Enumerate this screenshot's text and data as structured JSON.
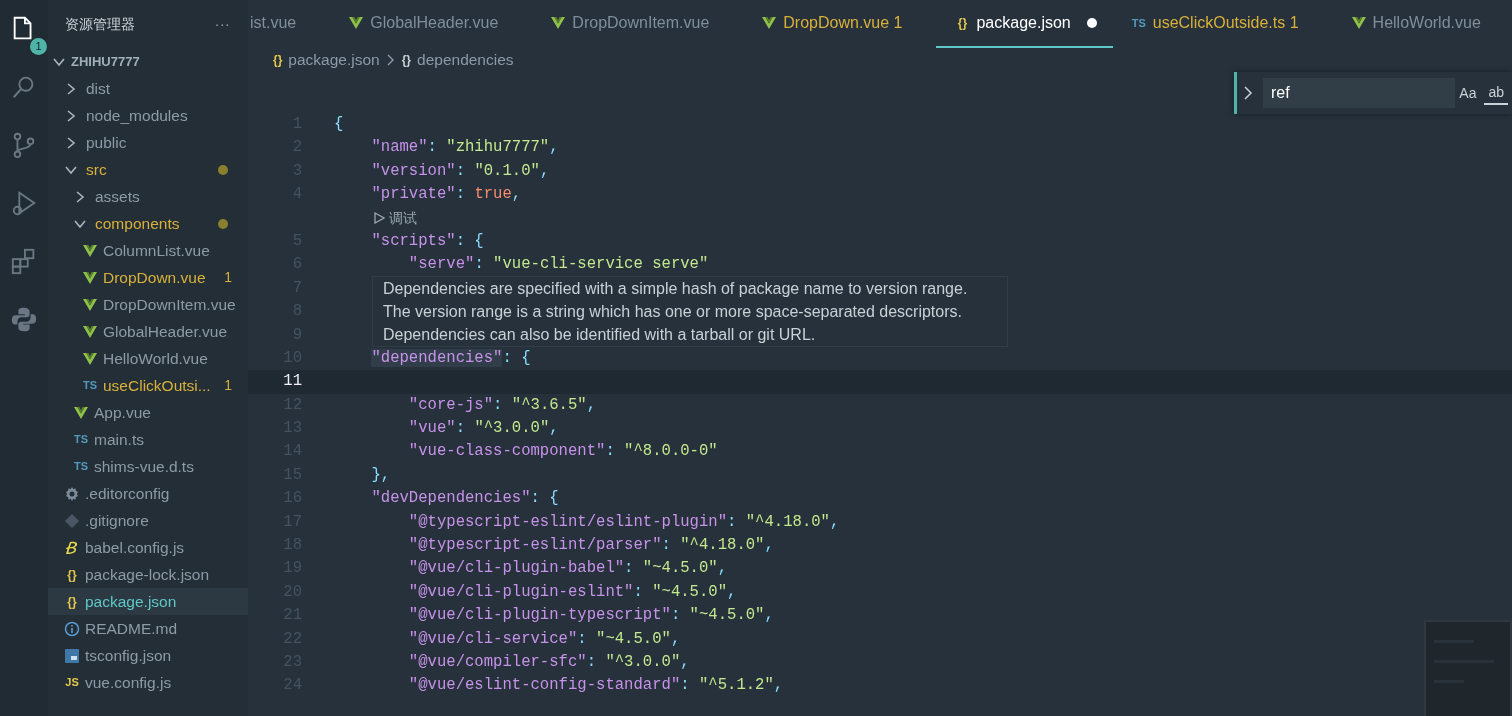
{
  "activity_bar": [
    {
      "kind": "files",
      "selected": true,
      "badge": "1"
    },
    {
      "kind": "search",
      "selected": false
    },
    {
      "kind": "source-control",
      "selected": false
    },
    {
      "kind": "run",
      "selected": false
    },
    {
      "kind": "extensions",
      "selected": false
    },
    {
      "kind": "python",
      "selected": false
    }
  ],
  "sidebar": {
    "title": "资源管理器",
    "more": "···",
    "tree": [
      {
        "kind": "root",
        "name": "ZHIHU7777",
        "expanded": true,
        "children": [
          {
            "kind": "folder",
            "name": "dist",
            "expanded": false,
            "modified": false,
            "selected": false
          },
          {
            "kind": "folder",
            "name": "node_modules",
            "expanded": false,
            "modified": false,
            "selected": false
          },
          {
            "kind": "folder",
            "name": "public",
            "expanded": false,
            "modified": false,
            "selected": false
          },
          {
            "kind": "folder",
            "name": "src",
            "expanded": true,
            "modified": true,
            "selected": false,
            "children": [
              {
                "kind": "folder",
                "name": "assets",
                "expanded": false,
                "modified": false,
                "selected": false
              },
              {
                "kind": "folder",
                "name": "components",
                "expanded": true,
                "modified": true,
                "selected": false,
                "children": [
                  {
                    "kind": "vue-file",
                    "name": "ColumnList.vue",
                    "modified": false,
                    "selected": false
                  },
                  {
                    "kind": "vue-file",
                    "name": "DropDown.vue",
                    "modified": true,
                    "problems": "1",
                    "selected": false
                  },
                  {
                    "kind": "vue-file",
                    "name": "DropDownItem.vue",
                    "modified": false,
                    "selected": false
                  },
                  {
                    "kind": "vue-file",
                    "name": "GlobalHeader.vue",
                    "modified": false,
                    "selected": false
                  },
                  {
                    "kind": "vue-file",
                    "name": "HelloWorld.vue",
                    "modified": false,
                    "selected": false
                  },
                  {
                    "kind": "ts-file",
                    "icon_label": "TS",
                    "name": "useClickOutsi...",
                    "modified": true,
                    "problems": "1",
                    "selected": false
                  }
                ]
              },
              {
                "kind": "vue-file",
                "name": "App.vue",
                "modified": false,
                "selected": false
              },
              {
                "kind": "ts-file",
                "icon_label": "TS",
                "name": "main.ts",
                "modified": false,
                "selected": false
              },
              {
                "kind": "ts-file",
                "icon_label": "TS",
                "name": "shims-vue.d.ts",
                "modified": false,
                "selected": false
              }
            ]
          },
          {
            "kind": "config-file",
            "name": ".editorconfig",
            "modified": false,
            "selected": false
          },
          {
            "kind": "ignore-file",
            "name": ".gitignore",
            "modified": false,
            "selected": false
          },
          {
            "kind": "babel-file",
            "name": "babel.config.js",
            "modified": false,
            "selected": false
          },
          {
            "kind": "json-file",
            "icon_label": "{}",
            "name": "package-lock.json",
            "modified": false,
            "selected": false
          },
          {
            "kind": "json-file",
            "icon_label": "{}",
            "name": "package.json",
            "modified": false,
            "selected": true
          },
          {
            "kind": "readme-file",
            "name": "README.md",
            "modified": false,
            "selected": false
          },
          {
            "kind": "tsconfig-file",
            "name": "tsconfig.json",
            "modified": false,
            "selected": false
          },
          {
            "kind": "js-file",
            "icon_label": "JS",
            "name": "vue.config.js",
            "modified": false,
            "selected": false
          }
        ]
      }
    ]
  },
  "tabs": [
    {
      "kind": "partial",
      "label": "ist.vue",
      "modified": false,
      "dirty": false,
      "selected": false
    },
    {
      "kind": "vue-file",
      "label": "GlobalHeader.vue",
      "modified": false,
      "dirty": false,
      "selected": false
    },
    {
      "kind": "vue-file",
      "label": "DropDownItem.vue",
      "modified": false,
      "dirty": false,
      "selected": false
    },
    {
      "kind": "vue-file",
      "label": "DropDown.vue",
      "modified": true,
      "problems": "1",
      "dirty": false,
      "selected": false
    },
    {
      "kind": "json-file",
      "icon_label": "{}",
      "label": "package.json",
      "modified": false,
      "dirty": true,
      "selected": true
    },
    {
      "kind": "ts-file",
      "icon_label": "TS",
      "label": "useClickOutside.ts",
      "modified": true,
      "problems": "1",
      "dirty": false,
      "selected": false
    },
    {
      "kind": "vue-file",
      "label": "HelloWorld.vue",
      "modified": false,
      "dirty": false,
      "selected": false
    }
  ],
  "breadcrumb": [
    {
      "icon_label": "{}",
      "text": "package.json"
    },
    {
      "icon_label": "{}",
      "text": "dependencies"
    }
  ],
  "find_widget": {
    "value": "ref",
    "options": [
      "Aa",
      "ab"
    ]
  },
  "code": [
    {
      "kind": "line",
      "number": "1",
      "current": false,
      "tokens": [
        {
          "kind": "punct",
          "text": "{"
        }
      ]
    },
    {
      "kind": "line",
      "number": "2",
      "current": false,
      "tokens": [
        {
          "kind": "key",
          "text": "    \"name\""
        },
        {
          "kind": "punct",
          "text": ": "
        },
        {
          "kind": "str",
          "text": "\"zhihu7777\""
        },
        {
          "kind": "punct",
          "text": ","
        }
      ]
    },
    {
      "kind": "line",
      "number": "3",
      "current": false,
      "tokens": [
        {
          "kind": "key",
          "text": "    \"version\""
        },
        {
          "kind": "punct",
          "text": ": "
        },
        {
          "kind": "str",
          "text": "\"0.1.0\""
        },
        {
          "kind": "punct",
          "text": ","
        }
      ]
    },
    {
      "kind": "line",
      "number": "4",
      "current": false,
      "tokens": [
        {
          "kind": "key",
          "text": "    \"private\""
        },
        {
          "kind": "punct",
          "text": ": "
        },
        {
          "kind": "bool",
          "text": "true"
        },
        {
          "kind": "punct",
          "text": ","
        }
      ]
    },
    {
      "kind": "codelens",
      "text": "调试"
    },
    {
      "kind": "line",
      "number": "5",
      "current": false,
      "tokens": [
        {
          "kind": "key",
          "text": "    \"scripts\""
        },
        {
          "kind": "punct",
          "text": ": {"
        }
      ]
    },
    {
      "kind": "line",
      "number": "6",
      "current": false,
      "tokens": [
        {
          "kind": "key",
          "text": "        \"serve\""
        },
        {
          "kind": "punct",
          "text": ": "
        },
        {
          "kind": "str",
          "text": "\"vue-cli-service serve\""
        }
      ]
    },
    {
      "kind": "line",
      "number": "7",
      "current": false
    },
    {
      "kind": "line",
      "number": "8",
      "current": false
    },
    {
      "kind": "line",
      "number": "9",
      "current": false
    },
    {
      "kind": "tooltip",
      "text": "Dependencies are specified with a simple hash of package name to version range. The version range is a string which has one or more space-separated descriptors. Dependencies can also be identified with a tarball or git URL."
    },
    {
      "kind": "line",
      "number": "10",
      "current": false,
      "tokens": [
        {
          "kind": "key",
          "text": "    \"dependencies\"",
          "hovered": true
        },
        {
          "kind": "punct",
          "text": ": {"
        }
      ]
    },
    {
      "kind": "line",
      "number": "11",
      "current": true
    },
    {
      "kind": "line",
      "number": "12",
      "current": false,
      "tokens": [
        {
          "kind": "key",
          "text": "        \"core-js\""
        },
        {
          "kind": "punct",
          "text": ": "
        },
        {
          "kind": "str",
          "text": "\"^3.6.5\""
        },
        {
          "kind": "punct",
          "text": ","
        }
      ]
    },
    {
      "kind": "line",
      "number": "13",
      "current": false,
      "tokens": [
        {
          "kind": "key",
          "text": "        \"vue\""
        },
        {
          "kind": "punct",
          "text": ": "
        },
        {
          "kind": "str",
          "text": "\"^3.0.0\""
        },
        {
          "kind": "punct",
          "text": ","
        }
      ]
    },
    {
      "kind": "line",
      "number": "14",
      "current": false,
      "tokens": [
        {
          "kind": "key",
          "text": "        \"vue-class-component\""
        },
        {
          "kind": "punct",
          "text": ": "
        },
        {
          "kind": "str",
          "text": "\"^8.0.0-0\""
        }
      ]
    },
    {
      "kind": "line",
      "number": "15",
      "current": false,
      "tokens": [
        {
          "kind": "punct",
          "text": "    },"
        }
      ]
    },
    {
      "kind": "line",
      "number": "16",
      "current": false,
      "tokens": [
        {
          "kind": "key",
          "text": "    \"devDependencies\""
        },
        {
          "kind": "punct",
          "text": ": {"
        }
      ]
    },
    {
      "kind": "line",
      "number": "17",
      "current": false,
      "tokens": [
        {
          "kind": "key",
          "text": "        \"@typescript-eslint/eslint-plugin\""
        },
        {
          "kind": "punct",
          "text": ": "
        },
        {
          "kind": "str",
          "text": "\"^4.18.0\""
        },
        {
          "kind": "punct",
          "text": ","
        }
      ]
    },
    {
      "kind": "line",
      "number": "18",
      "current": false,
      "tokens": [
        {
          "kind": "key",
          "text": "        \"@typescript-eslint/parser\""
        },
        {
          "kind": "punct",
          "text": ": "
        },
        {
          "kind": "str",
          "text": "\"^4.18.0\""
        },
        {
          "kind": "punct",
          "text": ","
        }
      ]
    },
    {
      "kind": "line",
      "number": "19",
      "current": false,
      "tokens": [
        {
          "kind": "key",
          "text": "        \"@vue/cli-plugin-babel\""
        },
        {
          "kind": "punct",
          "text": ": "
        },
        {
          "kind": "str",
          "text": "\"~4.5.0\""
        },
        {
          "kind": "punct",
          "text": ","
        }
      ]
    },
    {
      "kind": "line",
      "number": "20",
      "current": false,
      "tokens": [
        {
          "kind": "key",
          "text": "        \"@vue/cli-plugin-eslint\""
        },
        {
          "kind": "punct",
          "text": ": "
        },
        {
          "kind": "str",
          "text": "\"~4.5.0\""
        },
        {
          "kind": "punct",
          "text": ","
        }
      ]
    },
    {
      "kind": "line",
      "number": "21",
      "current": false,
      "tokens": [
        {
          "kind": "key",
          "text": "        \"@vue/cli-plugin-typescript\""
        },
        {
          "kind": "punct",
          "text": ": "
        },
        {
          "kind": "str",
          "text": "\"~4.5.0\""
        },
        {
          "kind": "punct",
          "text": ","
        }
      ]
    },
    {
      "kind": "line",
      "number": "22",
      "current": false,
      "tokens": [
        {
          "kind": "key",
          "text": "        \"@vue/cli-service\""
        },
        {
          "kind": "punct",
          "text": ": "
        },
        {
          "kind": "str",
          "text": "\"~4.5.0\""
        },
        {
          "kind": "punct",
          "text": ","
        }
      ]
    },
    {
      "kind": "line",
      "number": "23",
      "current": false,
      "tokens": [
        {
          "kind": "key",
          "text": "        \"@vue/compiler-sfc\""
        },
        {
          "kind": "punct",
          "text": ": "
        },
        {
          "kind": "str",
          "text": "\"^3.0.0\""
        },
        {
          "kind": "punct",
          "text": ","
        }
      ]
    },
    {
      "kind": "line",
      "number": "24",
      "current": false,
      "tokens": [
        {
          "kind": "key",
          "text": "        \"@vue/eslint-config-standard\""
        },
        {
          "kind": "punct",
          "text": ": "
        },
        {
          "kind": "str",
          "text": "\"^5.1.2\""
        },
        {
          "kind": "punct",
          "text": ","
        }
      ]
    }
  ]
}
